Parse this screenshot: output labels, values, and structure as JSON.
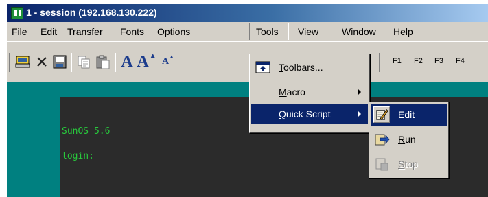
{
  "window": {
    "title": "1 - session (192.168.130.222)"
  },
  "menubar": {
    "items": [
      {
        "label": "File"
      },
      {
        "label": "Edit"
      },
      {
        "label": "Transfer"
      },
      {
        "label": "Fonts"
      },
      {
        "label": "Options"
      },
      {
        "label": "Tools"
      },
      {
        "label": "View"
      },
      {
        "label": "Window"
      },
      {
        "label": "Help"
      }
    ]
  },
  "toolbar": {
    "icons": [
      "connect-icon",
      "disconnect-icon",
      "session-properties-icon",
      "copy-icon",
      "paste-icon",
      "font-icon",
      "font-larger-icon",
      "font-smaller-icon"
    ],
    "font_glyphs": {
      "font": "A",
      "larger": "A",
      "smaller": "A"
    },
    "function_keys": [
      "F1",
      "F2",
      "F3",
      "F4"
    ]
  },
  "terminal": {
    "lines": [
      "SunOS 5.6",
      "login:"
    ],
    "text_color": "#28c83c",
    "background": "#2b2b2b"
  },
  "tools_menu": {
    "items": [
      {
        "first": "T",
        "rest": "oolbars...",
        "icon": "toolbars-icon",
        "has_submenu": false
      },
      {
        "first": "M",
        "rest": "acro",
        "has_submenu": true
      },
      {
        "first": "Q",
        "rest": "uick Script",
        "has_submenu": true,
        "highlighted": true
      }
    ]
  },
  "quick_script_submenu": {
    "items": [
      {
        "first": "E",
        "rest": "dit",
        "icon": "edit-script-icon",
        "highlighted": true,
        "enabled": true
      },
      {
        "first": "R",
        "rest": "un",
        "icon": "run-script-icon",
        "enabled": true
      },
      {
        "first": "S",
        "rest": "top",
        "icon": "stop-script-icon",
        "enabled": false
      }
    ]
  },
  "colors": {
    "accent": "#0a246a",
    "chrome": "#d4d0c8",
    "terminal_frame": "#008080"
  }
}
